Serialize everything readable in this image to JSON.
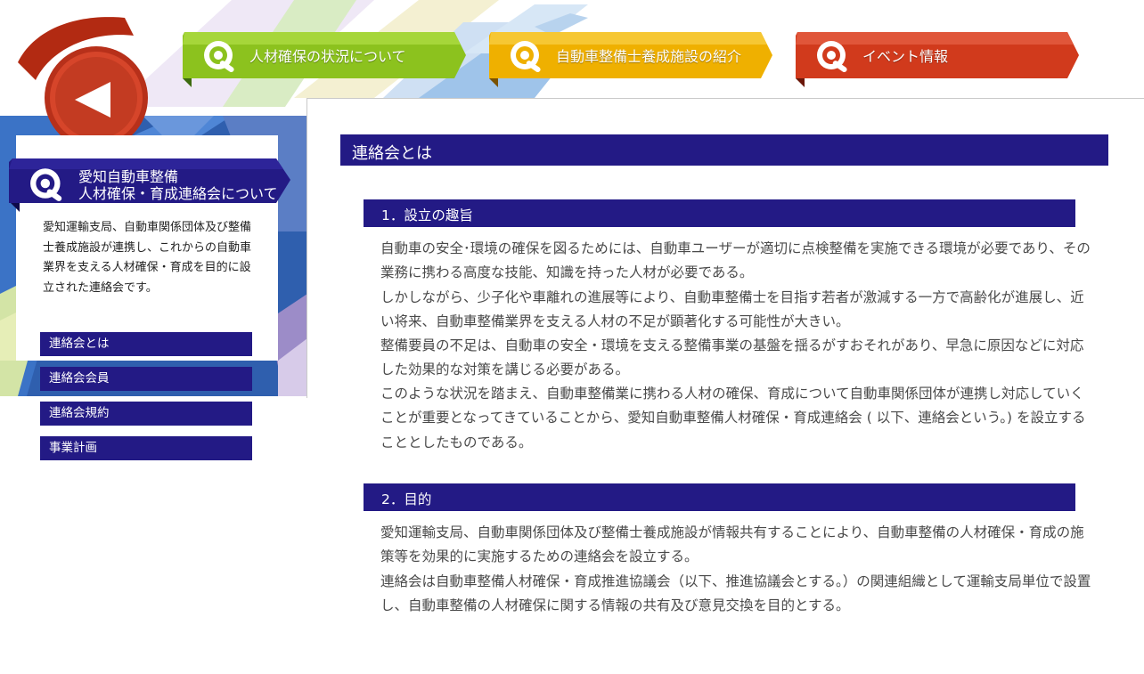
{
  "colors": {
    "navy": "#231a85",
    "nav1": "#8cc21e",
    "nav2": "#f0b400",
    "nav3": "#d4381c",
    "seal": "#cf3a1f"
  },
  "nav": [
    {
      "label": "人材確保の状況について",
      "icon": "gear-wrench-icon"
    },
    {
      "label": "自動車整備士養成施設の紹介",
      "icon": "gear-wrench-icon"
    },
    {
      "label": "イベント情報",
      "icon": "gear-wrench-icon"
    }
  ],
  "sidebar": {
    "title_line1": "愛知自動車整備",
    "title_line2": "人材確保・育成連絡会について",
    "description": "愛知運輸支局、自動車関係団体及び整備士養成施設が連携し、これからの自動車業界を支える人材確保・育成を目的に設立された連絡会です。",
    "menu": [
      {
        "label": "連絡会とは"
      },
      {
        "label": "連絡会会員"
      },
      {
        "label": "連絡会規約"
      },
      {
        "label": "事業計画"
      }
    ]
  },
  "main": {
    "title": "連絡会とは",
    "sections": [
      {
        "heading": "1．設立の趣旨",
        "paragraphs": [
          "自動車の安全･環境の確保を図るためには、自動車ユーザーが適切に点検整備を実施できる環境が必要であり、その業務に携わる高度な技能、知識を持った人材が必要である。",
          "しかしながら、少子化や車離れの進展等により、自動車整備士を目指す若者が激減する一方で高齢化が進展し、近い将来、自動車整備業界を支える人材の不足が顕著化する可能性が大きい。",
          "整備要員の不足は、自動車の安全・環境を支える整備事業の基盤を揺るがすおそれがあり、早急に原因などに対応した効果的な対策を講じる必要がある。",
          "このような状況を踏まえ、自動車整備業に携わる人材の確保、育成について自動車関係団体が連携し対応していくことが重要となってきていることから、愛知自動車整備人材確保・育成連絡会 ( 以下、連絡会という。) を設立することとしたものである。"
        ]
      },
      {
        "heading": "2．目的",
        "paragraphs": [
          "愛知運輸支局、自動車関係団体及び整備士養成施設が情報共有することにより、自動車整備の人材確保・育成の施策等を効果的に実施するための連絡会を設立する。",
          "連絡会は自動車整備人材確保・育成推進協議会（以下、推進協議会とする。）の関連組織として運輸支局単位で設置し、自動車整備の人材確保に関する情報の共有及び意見交換を目的とする。"
        ]
      }
    ]
  }
}
